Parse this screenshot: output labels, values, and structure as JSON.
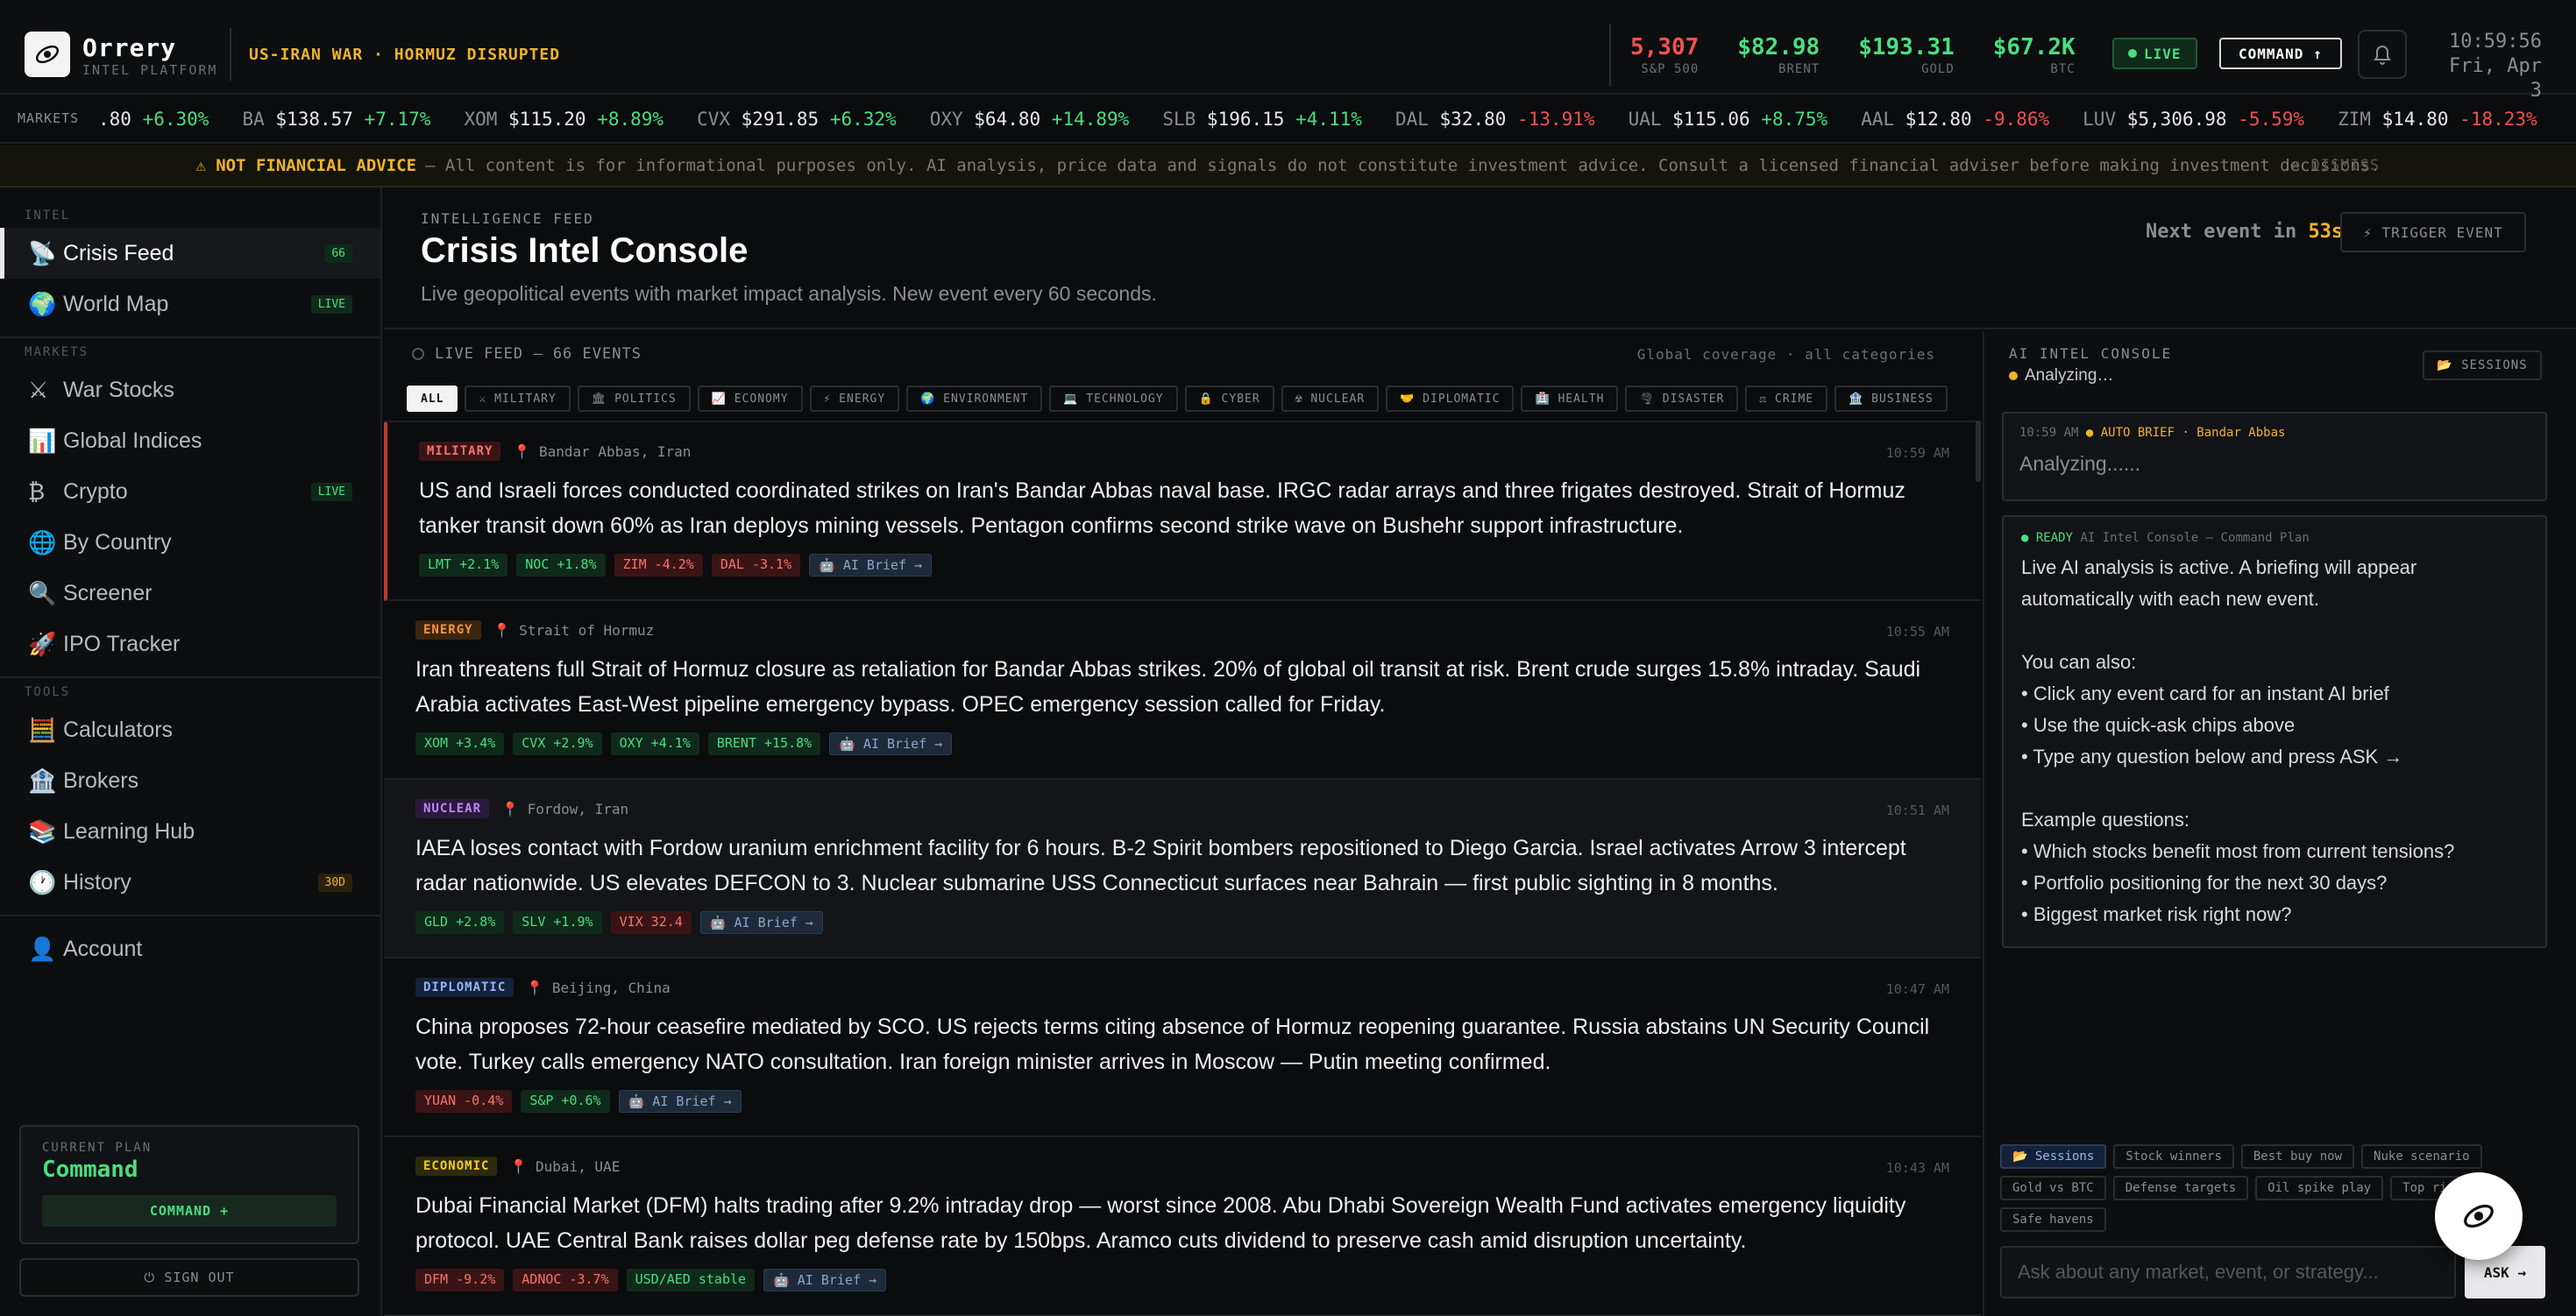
{
  "brand": {
    "name": "Orrery",
    "sub": "INTEL PLATFORM"
  },
  "alert": "US-IRAN WAR · HORMUZ DISRUPTED",
  "quotes": [
    {
      "value": "5,307",
      "label": "S&P 500",
      "color": "#f05252"
    },
    {
      "value": "$82.98",
      "label": "BRENT",
      "color": "#4ade80"
    },
    {
      "value": "$193.31",
      "label": "GOLD",
      "color": "#4ade80"
    },
    {
      "value": "$67.2K",
      "label": "BTC",
      "color": "#4ade80"
    }
  ],
  "live": "LIVE",
  "command_btn": "COMMAND ↑",
  "clock": {
    "time": "10:59:56",
    "date": "Fri, Apr 3"
  },
  "ticker": {
    "label": "MARKETS",
    "items": [
      {
        "sym": "",
        "price": ".80",
        "chg": "+6.30%",
        "dir": "pos"
      },
      {
        "sym": "BA",
        "price": "$138.57",
        "chg": "+7.17%",
        "dir": "pos"
      },
      {
        "sym": "XOM",
        "price": "$115.20",
        "chg": "+8.89%",
        "dir": "pos"
      },
      {
        "sym": "CVX",
        "price": "$291.85",
        "chg": "+6.32%",
        "dir": "pos"
      },
      {
        "sym": "OXY",
        "price": "$64.80",
        "chg": "+14.89%",
        "dir": "pos"
      },
      {
        "sym": "SLB",
        "price": "$196.15",
        "chg": "+4.11%",
        "dir": "pos"
      },
      {
        "sym": "DAL",
        "price": "$32.80",
        "chg": "-13.91%",
        "dir": "neg"
      },
      {
        "sym": "UAL",
        "price": "$115.06",
        "chg": "+8.75%",
        "dir": "pos"
      },
      {
        "sym": "AAL",
        "price": "$12.80",
        "chg": "-9.86%",
        "dir": "neg"
      },
      {
        "sym": "LUV",
        "price": "$5,306.98",
        "chg": "-5.59%",
        "dir": "neg"
      },
      {
        "sym": "ZIM",
        "price": "$14.80",
        "chg": "-18.23%",
        "dir": "neg"
      }
    ]
  },
  "disclaimer": {
    "warn": "⚠ NOT FINANCIAL ADVICE",
    "text": "— All content is for informational purposes only. AI analysis, price data and signals do not constitute investment advice. Consult a licensed financial adviser before making investment decisions.",
    "dismiss": "✕ DISMISS"
  },
  "sidebar": {
    "sections": [
      {
        "label": "INTEL",
        "items": [
          {
            "icon": "📡",
            "icon_name": "satellite-icon",
            "label": "Crisis Feed",
            "badge": "66",
            "badge_style": "green",
            "active": true
          },
          {
            "icon": "🌍",
            "icon_name": "globe-icon",
            "label": "World Map",
            "badge": "LIVE",
            "badge_style": "green"
          }
        ]
      },
      {
        "label": "MARKETS",
        "items": [
          {
            "icon": "⚔",
            "icon_name": "swords-icon",
            "label": "War Stocks"
          },
          {
            "icon": "📊",
            "icon_name": "bar-chart-icon",
            "label": "Global Indices"
          },
          {
            "icon": "₿",
            "icon_name": "bitcoin-icon",
            "label": "Crypto",
            "badge": "LIVE",
            "badge_style": "green"
          },
          {
            "icon": "🌐",
            "icon_name": "world-icon",
            "label": "By Country"
          },
          {
            "icon": "🔍",
            "icon_name": "magnifier-icon",
            "label": "Screener"
          },
          {
            "icon": "🚀",
            "icon_name": "rocket-icon",
            "label": "IPO Tracker"
          }
        ]
      },
      {
        "label": "TOOLS",
        "items": [
          {
            "icon": "🧮",
            "icon_name": "abacus-icon",
            "label": "Calculators"
          },
          {
            "icon": "🏦",
            "icon_name": "bank-icon",
            "label": "Brokers"
          },
          {
            "icon": "📚",
            "icon_name": "books-icon",
            "label": "Learning Hub"
          },
          {
            "icon": "🕐",
            "icon_name": "clock-icon",
            "label": "History",
            "badge": "30D",
            "badge_style": "yellow"
          }
        ]
      }
    ],
    "account": {
      "icon": "👤",
      "label": "Account"
    },
    "plan": {
      "key": "CURRENT PLAN",
      "name": "Command",
      "button": "COMMAND +"
    },
    "signout": "⏻ SIGN OUT"
  },
  "header": {
    "kicker": "INTELLIGENCE FEED",
    "title": "Crisis Intel Console",
    "subtitle": "Live geopolitical events with market impact analysis. New event every 60 seconds.",
    "next_prefix": "Next event in",
    "next_value": "53s",
    "trigger": "⚡ TRIGGER EVENT"
  },
  "feed": {
    "head": "LIVE FEED — 66 EVENTS",
    "coverage": "Global coverage · all categories",
    "filters": [
      "ALL",
      "⚔ MILITARY",
      "🏛 POLITICS",
      "📈 ECONOMY",
      "⚡ ENERGY",
      "🌍 ENVIRONMENT",
      "💻 TECHNOLOGY",
      "🔒 CYBER",
      "☢ NUCLEAR",
      "🤝 DIPLOMATIC",
      "🏥 HEALTH",
      "🌪 DISASTER",
      "⚖ CRIME",
      "🏦 BUSINESS"
    ],
    "events": [
      {
        "cat": "MILITARY",
        "cat_class": "c-mil",
        "loc": "📍 Bandar Abbas, Iran",
        "time": "10:59 AM",
        "body": "US and Israeli forces conducted coordinated strikes on Iran's Bandar Abbas naval base. IRGC radar arrays and three frigates destroyed. Strait of Hormuz tanker transit down 60% as Iran deploys mining vessels. Pentagon confirms second strike wave on Bushehr support infrastructure.",
        "tags": [
          {
            "t": "LMT +2.1%",
            "d": "pos"
          },
          {
            "t": "NOC +1.8%",
            "d": "pos"
          },
          {
            "t": "ZIM -4.2%",
            "d": "neg"
          },
          {
            "t": "DAL -3.1%",
            "d": "neg"
          },
          {
            "t": "🤖 AI Brief →",
            "d": "ai"
          }
        ]
      },
      {
        "cat": "ENERGY",
        "cat_class": "c-en",
        "loc": "📍 Strait of Hormuz",
        "time": "10:55 AM",
        "body": "Iran threatens full Strait of Hormuz closure as retaliation for Bandar Abbas strikes. 20% of global oil transit at risk. Brent crude surges 15.8% intraday. Saudi Arabia activates East-West pipeline emergency bypass. OPEC emergency session called for Friday.",
        "tags": [
          {
            "t": "XOM +3.4%",
            "d": "pos"
          },
          {
            "t": "CVX +2.9%",
            "d": "pos"
          },
          {
            "t": "OXY +4.1%",
            "d": "pos"
          },
          {
            "t": "BRENT +15.8%",
            "d": "pos"
          },
          {
            "t": "🤖 AI Brief →",
            "d": "ai"
          }
        ]
      },
      {
        "cat": "NUCLEAR",
        "cat_class": "c-nuc",
        "loc": "📍 Fordow, Iran",
        "time": "10:51 AM",
        "body": "IAEA loses contact with Fordow uranium enrichment facility for 6 hours. B-2 Spirit bombers repositioned to Diego Garcia. Israel activates Arrow 3 intercept radar nationwide. US elevates DEFCON to 3. Nuclear submarine USS Connecticut surfaces near Bahrain — first public sighting in 8 months.",
        "tags": [
          {
            "t": "GLD +2.8%",
            "d": "pos"
          },
          {
            "t": "SLV +1.9%",
            "d": "pos"
          },
          {
            "t": "VIX 32.4",
            "d": "neg"
          },
          {
            "t": "🤖 AI Brief →",
            "d": "ai"
          }
        ]
      },
      {
        "cat": "DIPLOMATIC",
        "cat_class": "c-dip",
        "loc": "📍 Beijing, China",
        "time": "10:47 AM",
        "body": "China proposes 72-hour ceasefire mediated by SCO. US rejects terms citing absence of Hormuz reopening guarantee. Russia abstains UN Security Council vote. Turkey calls emergency NATO consultation. Iran foreign minister arrives in Moscow — Putin meeting confirmed.",
        "tags": [
          {
            "t": "YUAN -0.4%",
            "d": "neg"
          },
          {
            "t": "S&P +0.6%",
            "d": "pos"
          },
          {
            "t": "🤖 AI Brief →",
            "d": "ai"
          }
        ]
      },
      {
        "cat": "ECONOMIC",
        "cat_class": "c-eco",
        "loc": "📍 Dubai, UAE",
        "time": "10:43 AM",
        "body": "Dubai Financial Market (DFM) halts trading after 9.2% intraday drop — worst since 2008. Abu Dhabi Sovereign Wealth Fund activates emergency liquidity protocol. UAE Central Bank raises dollar peg defense rate by 150bps. Aramco cuts dividend to preserve cash amid disruption uncertainty.",
        "tags": [
          {
            "t": "DFM -9.2%",
            "d": "neg"
          },
          {
            "t": "ADNOC -3.7%",
            "d": "neg"
          },
          {
            "t": "USD/AED stable",
            "d": "pos"
          },
          {
            "t": "🤖 AI Brief →",
            "d": "ai"
          }
        ]
      }
    ]
  },
  "ai": {
    "kicker": "AI INTEL CONSOLE",
    "status": "Analyzing…",
    "sessions": "📂 SESSIONS",
    "card1": {
      "time": "10:59 AM",
      "tag": "● AUTO BRIEF · Bandar Abbas",
      "text": "Analyzing......"
    },
    "card2": {
      "ready": "● READY",
      "title": "AI Intel Console — Command Plan",
      "text": "Live AI analysis is active. A briefing will appear automatically with each new event.\n\nYou can also:\n• Click any event card for an instant AI brief\n• Use the quick-ask chips above\n• Type any question below and press ASK →\n\nExample questions:\n• Which stocks benefit most from current tensions?\n• Portfolio positioning for the next 30 days?\n• Biggest market risk right now?"
    },
    "chips": [
      "📂 Sessions",
      "Stock winners",
      "Best buy now",
      "Nuke scenario",
      "Gold vs BTC",
      "Defense targets",
      "Oil spike play",
      "Top risk",
      "Safe havens"
    ],
    "placeholder": "Ask about any market, event, or strategy...",
    "ask": "ASK →"
  }
}
